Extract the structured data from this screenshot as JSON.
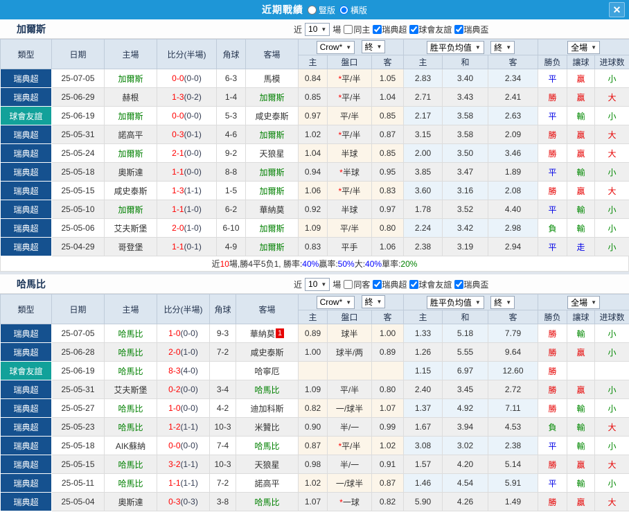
{
  "titlebar": {
    "title": "近期戰績",
    "radio_vertical": "豎版",
    "radio_horizontal": "橫版",
    "close_glyph": "✕"
  },
  "filters": {
    "near": "近",
    "count": "10",
    "games": "場",
    "crow": "Crow*",
    "final": "終",
    "avg": "胜平负均值",
    "full": "全場"
  },
  "columns": {
    "type": "類型",
    "date": "日期",
    "home": "主場",
    "score": "比分(半場)",
    "corner": "角球",
    "away": "客場",
    "h": "主",
    "handicap": "盤口",
    "a": "客",
    "h2": "主",
    "d": "和",
    "a2": "客",
    "result": "勝负",
    "cover": "讓球",
    "goals": "进球数"
  },
  "sections": [
    {
      "team": "加爾斯",
      "same_label": "同主",
      "leagues": [
        "瑞典超",
        "球會友誼",
        "瑞典盃"
      ],
      "rows": [
        {
          "league": "super",
          "type": "瑞典超",
          "date": "25-07-05",
          "home": "加爾斯",
          "home_hl": true,
          "ft": "0-0",
          "ht": "(0-0)",
          "corner": "6-3",
          "away": "馬模",
          "away_hl": false,
          "o1": "0.84",
          "star": true,
          "hcap": "平/半",
          "o2": "1.05",
          "m1": "2.83",
          "m2": "3.40",
          "m3": "2.34",
          "res": "平",
          "cover": "贏",
          "goals": "小"
        },
        {
          "league": "super",
          "type": "瑞典超",
          "date": "25-06-29",
          "home": "赫根",
          "home_hl": false,
          "ft": "1-3",
          "ht": "(0-2)",
          "corner": "1-4",
          "away": "加爾斯",
          "away_hl": true,
          "o1": "0.85",
          "star": true,
          "hcap": "平/半",
          "o2": "1.04",
          "m1": "2.71",
          "m2": "3.43",
          "m3": "2.41",
          "res": "勝",
          "cover": "贏",
          "goals": "大"
        },
        {
          "league": "friendly",
          "type": "球會友誼",
          "date": "25-06-19",
          "home": "加爾斯",
          "home_hl": true,
          "ft": "0-0",
          "ht": "(0-0)",
          "corner": "5-3",
          "away": "咸史泰斯",
          "away_hl": false,
          "o1": "0.97",
          "star": false,
          "hcap": "平/半",
          "o2": "0.85",
          "m1": "2.17",
          "m2": "3.58",
          "m3": "2.63",
          "res": "平",
          "cover": "輸",
          "goals": "小"
        },
        {
          "league": "super",
          "type": "瑞典超",
          "date": "25-05-31",
          "home": "諾高平",
          "home_hl": false,
          "ft": "0-3",
          "ht": "(0-1)",
          "corner": "4-6",
          "away": "加爾斯",
          "away_hl": true,
          "o1": "1.02",
          "star": true,
          "hcap": "平/半",
          "o2": "0.87",
          "m1": "3.15",
          "m2": "3.58",
          "m3": "2.09",
          "res": "勝",
          "cover": "贏",
          "goals": "大"
        },
        {
          "league": "super",
          "type": "瑞典超",
          "date": "25-05-24",
          "home": "加爾斯",
          "home_hl": true,
          "ft": "2-1",
          "ht": "(0-0)",
          "corner": "9-2",
          "away": "天狼星",
          "away_hl": false,
          "o1": "1.04",
          "star": false,
          "hcap": "半球",
          "o2": "0.85",
          "m1": "2.00",
          "m2": "3.50",
          "m3": "3.46",
          "res": "勝",
          "cover": "贏",
          "goals": "大"
        },
        {
          "league": "super",
          "type": "瑞典超",
          "date": "25-05-18",
          "home": "奧斯達",
          "home_hl": false,
          "ft": "1-1",
          "ht": "(0-0)",
          "corner": "8-8",
          "away": "加爾斯",
          "away_hl": true,
          "o1": "0.94",
          "star": true,
          "hcap": "半球",
          "o2": "0.95",
          "m1": "3.85",
          "m2": "3.47",
          "m3": "1.89",
          "res": "平",
          "cover": "輸",
          "goals": "小"
        },
        {
          "league": "super",
          "type": "瑞典超",
          "date": "25-05-15",
          "home": "咸史泰斯",
          "home_hl": false,
          "ft": "1-3",
          "ht": "(1-1)",
          "corner": "1-5",
          "away": "加爾斯",
          "away_hl": true,
          "o1": "1.06",
          "star": true,
          "hcap": "平/半",
          "o2": "0.83",
          "m1": "3.60",
          "m2": "3.16",
          "m3": "2.08",
          "res": "勝",
          "cover": "贏",
          "goals": "大"
        },
        {
          "league": "super",
          "type": "瑞典超",
          "date": "25-05-10",
          "home": "加爾斯",
          "home_hl": true,
          "ft": "1-1",
          "ht": "(1-0)",
          "corner": "6-2",
          "away": "華納莫",
          "away_hl": false,
          "o1": "0.92",
          "star": false,
          "hcap": "半球",
          "o2": "0.97",
          "m1": "1.78",
          "m2": "3.52",
          "m3": "4.40",
          "res": "平",
          "cover": "輸",
          "goals": "小"
        },
        {
          "league": "super",
          "type": "瑞典超",
          "date": "25-05-06",
          "home": "艾夫斯堡",
          "home_hl": false,
          "ft": "2-0",
          "ht": "(1-0)",
          "corner": "6-10",
          "away": "加爾斯",
          "away_hl": true,
          "o1": "1.09",
          "star": false,
          "hcap": "平/半",
          "o2": "0.80",
          "m1": "2.24",
          "m2": "3.42",
          "m3": "2.98",
          "res": "負",
          "cover": "輸",
          "goals": "小"
        },
        {
          "league": "super",
          "type": "瑞典超",
          "date": "25-04-29",
          "home": "哥登堡",
          "home_hl": false,
          "ft": "1-1",
          "ht": "(0-1)",
          "corner": "4-9",
          "away": "加爾斯",
          "away_hl": true,
          "o1": "0.83",
          "star": false,
          "hcap": "平手",
          "o2": "1.06",
          "m1": "2.38",
          "m2": "3.19",
          "m3": "2.94",
          "res": "平",
          "cover": "走",
          "goals": "小"
        }
      ],
      "summary": {
        "parts": [
          {
            "text": "近",
            "color": "#333333"
          },
          {
            "text": "10",
            "color": "#ff0000"
          },
          {
            "text": "場,勝4平5负1, 勝率:",
            "color": "#333333"
          },
          {
            "text": "40%",
            "color": "#0000ff"
          },
          {
            "text": " 贏率:",
            "color": "#333333"
          },
          {
            "text": "50%",
            "color": "#0000ff"
          },
          {
            "text": " 大:",
            "color": "#333333"
          },
          {
            "text": "40%",
            "color": "#0000ff"
          },
          {
            "text": " 單率:",
            "color": "#333333"
          },
          {
            "text": "20%",
            "color": "#008000"
          }
        ]
      }
    },
    {
      "team": "哈馬比",
      "same_label": "同客",
      "leagues": [
        "瑞典超",
        "球會友誼",
        "瑞典盃"
      ],
      "rows": [
        {
          "league": "super",
          "type": "瑞典超",
          "date": "25-07-05",
          "home": "哈馬比",
          "home_hl": true,
          "ft": "1-0",
          "ht": "(0-0)",
          "corner": "9-3",
          "away": "華納莫",
          "away_hl": false,
          "badge": "1",
          "o1": "0.89",
          "star": false,
          "hcap": "球半",
          "o2": "1.00",
          "m1": "1.33",
          "m2": "5.18",
          "m3": "7.79",
          "res": "勝",
          "cover": "輸",
          "goals": "小"
        },
        {
          "league": "super",
          "type": "瑞典超",
          "date": "25-06-28",
          "home": "哈馬比",
          "home_hl": true,
          "ft": "2-0",
          "ht": "(1-0)",
          "corner": "7-2",
          "away": "咸史泰斯",
          "away_hl": false,
          "o1": "1.00",
          "star": false,
          "hcap": "球半/两",
          "o2": "0.89",
          "m1": "1.26",
          "m2": "5.55",
          "m3": "9.64",
          "res": "勝",
          "cover": "贏",
          "goals": "小"
        },
        {
          "league": "friendly",
          "type": "球會友誼",
          "date": "25-06-19",
          "home": "哈馬比",
          "home_hl": true,
          "ft": "8-3",
          "ht": "(4-0)",
          "corner": "",
          "away": "哈寧厄",
          "away_hl": false,
          "o1": "",
          "star": false,
          "hcap": "",
          "o2": "",
          "m1": "1.15",
          "m2": "6.97",
          "m3": "12.60",
          "res": "勝",
          "cover": "",
          "goals": ""
        },
        {
          "league": "super",
          "type": "瑞典超",
          "date": "25-05-31",
          "home": "艾夫斯堡",
          "home_hl": false,
          "ft": "0-2",
          "ht": "(0-0)",
          "corner": "3-4",
          "away": "哈馬比",
          "away_hl": true,
          "o1": "1.09",
          "star": false,
          "hcap": "平/半",
          "o2": "0.80",
          "m1": "2.40",
          "m2": "3.45",
          "m3": "2.72",
          "res": "勝",
          "cover": "贏",
          "goals": "小"
        },
        {
          "league": "super",
          "type": "瑞典超",
          "date": "25-05-27",
          "home": "哈馬比",
          "home_hl": true,
          "ft": "1-0",
          "ht": "(0-0)",
          "corner": "4-2",
          "away": "迪加科斯",
          "away_hl": false,
          "o1": "0.82",
          "star": false,
          "hcap": "一/球半",
          "o2": "1.07",
          "m1": "1.37",
          "m2": "4.92",
          "m3": "7.11",
          "res": "勝",
          "cover": "輸",
          "goals": "小"
        },
        {
          "league": "super",
          "type": "瑞典超",
          "date": "25-05-23",
          "home": "哈馬比",
          "home_hl": true,
          "ft": "1-2",
          "ht": "(1-1)",
          "corner": "10-3",
          "away": "米贊比",
          "away_hl": false,
          "o1": "0.90",
          "star": false,
          "hcap": "半/一",
          "o2": "0.99",
          "m1": "1.67",
          "m2": "3.94",
          "m3": "4.53",
          "res": "負",
          "cover": "輸",
          "goals": "大"
        },
        {
          "league": "super",
          "type": "瑞典超",
          "date": "25-05-18",
          "home": "AIK蘇納",
          "home_hl": false,
          "ft": "0-0",
          "ht": "(0-0)",
          "corner": "7-4",
          "away": "哈馬比",
          "away_hl": true,
          "o1": "0.87",
          "star": true,
          "hcap": "平/半",
          "o2": "1.02",
          "m1": "3.08",
          "m2": "3.02",
          "m3": "2.38",
          "res": "平",
          "cover": "輸",
          "goals": "小"
        },
        {
          "league": "super",
          "type": "瑞典超",
          "date": "25-05-15",
          "home": "哈馬比",
          "home_hl": true,
          "ft": "3-2",
          "ht": "(1-1)",
          "corner": "10-3",
          "away": "天狼星",
          "away_hl": false,
          "o1": "0.98",
          "star": false,
          "hcap": "半/一",
          "o2": "0.91",
          "m1": "1.57",
          "m2": "4.20",
          "m3": "5.14",
          "res": "勝",
          "cover": "贏",
          "goals": "大"
        },
        {
          "league": "super",
          "type": "瑞典超",
          "date": "25-05-11",
          "home": "哈馬比",
          "home_hl": true,
          "ft": "1-1",
          "ht": "(1-1)",
          "corner": "7-2",
          "away": "諾高平",
          "away_hl": false,
          "o1": "1.02",
          "star": false,
          "hcap": "一/球半",
          "o2": "0.87",
          "m1": "1.46",
          "m2": "4.54",
          "m3": "5.91",
          "res": "平",
          "cover": "輸",
          "goals": "小"
        },
        {
          "league": "super",
          "type": "瑞典超",
          "date": "25-05-04",
          "home": "奧斯達",
          "home_hl": false,
          "ft": "0-3",
          "ht": "(0-3)",
          "corner": "3-8",
          "away": "哈馬比",
          "away_hl": true,
          "o1": "1.07",
          "star": true,
          "hcap": "一球",
          "o2": "0.82",
          "m1": "5.90",
          "m2": "4.26",
          "m3": "1.49",
          "res": "勝",
          "cover": "贏",
          "goals": "大"
        }
      ]
    }
  ]
}
